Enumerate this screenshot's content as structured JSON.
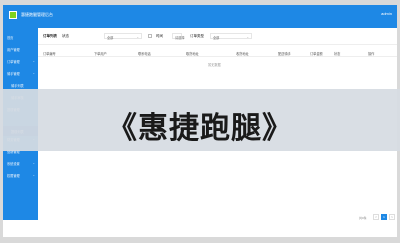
{
  "header": {
    "app_title": "惠捷跑腿管理后台",
    "user": "admin"
  },
  "sidebar": {
    "items": [
      {
        "label": "首页",
        "chevron": ""
      },
      {
        "label": "用户管理",
        "chevron": ""
      },
      {
        "label": "订单管理",
        "chevron": "⌄"
      },
      {
        "label": "骑手管理",
        "chevron": "⌄"
      },
      {
        "label": "骑手列表",
        "chevron": ""
      },
      {
        "label": "骑手审核",
        "chevron": ""
      },
      {
        "label": "提现管理",
        "chevron": ""
      },
      {
        "label": "提现列表",
        "chevron": ""
      },
      {
        "label": "财务管理",
        "chevron": "⌄"
      },
      {
        "label": "营销管理",
        "chevron": ""
      },
      {
        "label": "系统设置",
        "chevron": "⌄"
      },
      {
        "label": "权限管理",
        "chevron": "⌄"
      }
    ],
    "active_index": 5
  },
  "filters": {
    "title": "订单列表",
    "status_label": "状态",
    "status_value": "全部",
    "date_label": "时间",
    "date_value": "请选择",
    "type_label": "订单类型",
    "type_value": "全部"
  },
  "table": {
    "columns": [
      "订单编号",
      "下单用户",
      "联系电话",
      "取货地址",
      "收货地址",
      "配送骑手",
      "订单金额",
      "状态",
      "操作"
    ]
  },
  "empty_message": "暂无数据",
  "pagination": {
    "total": "共0条",
    "prev": "<",
    "page": "1",
    "next": ">"
  },
  "overlay": {
    "title": "《惠捷跑腿》"
  },
  "colors": {
    "primary": "#1e88e5",
    "logo": "#7ed321",
    "overlay": "#d6dbe2"
  }
}
